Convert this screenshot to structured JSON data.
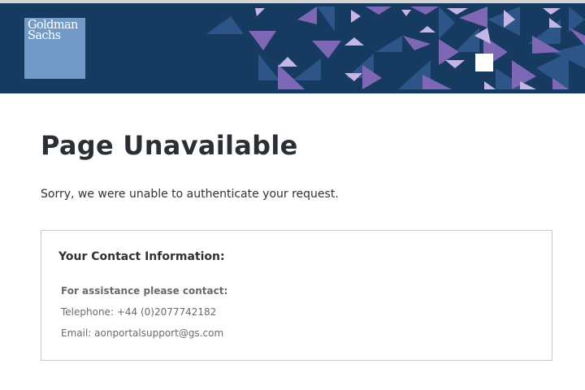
{
  "header": {
    "logo": {
      "text": "Goldman\nSachs",
      "background": "#7399c6",
      "text_color": "#ffffff"
    },
    "background": "#163a60",
    "pattern_colors": [
      "#2d5587",
      "#7e67b5",
      "#9f8ad0",
      "#c4b7e6",
      "#ffffff"
    ]
  },
  "page": {
    "title": "Page Unavailable",
    "message": "Sorry, we were unable to authenticate your request."
  },
  "contact": {
    "heading": "Your Contact Information:",
    "assist_label": "For assistance please contact:",
    "phone_prefix": "Telephone: ",
    "phone": "+44 (0)2077742182",
    "email_prefix": "Email: ",
    "email": "aonportalsupport@gs.com"
  }
}
